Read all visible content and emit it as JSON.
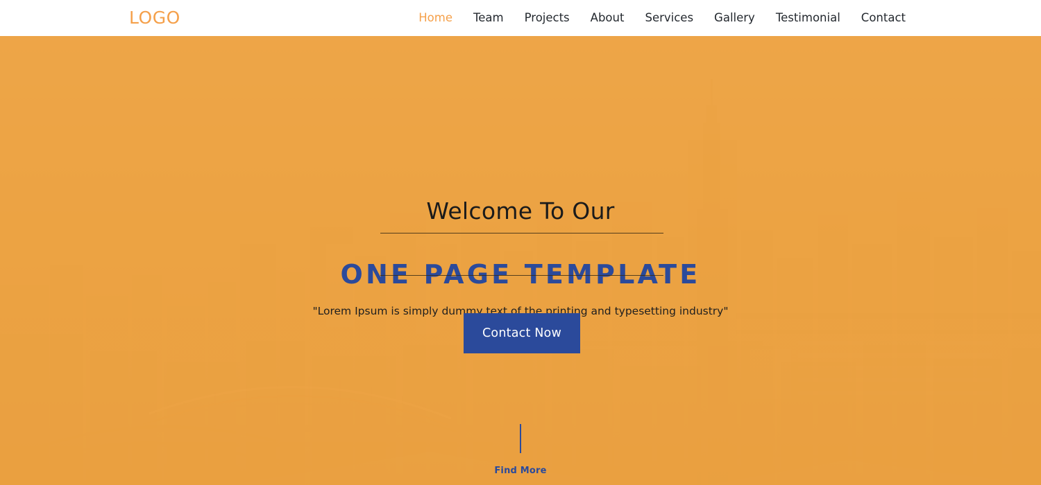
{
  "header": {
    "logo_text": "LOGO",
    "nav_items": [
      {
        "label": "Home",
        "active": true
      },
      {
        "label": "Team",
        "active": false
      },
      {
        "label": "Projects",
        "active": false
      },
      {
        "label": "About",
        "active": false
      },
      {
        "label": "Services",
        "active": false
      },
      {
        "label": "Gallery",
        "active": false
      },
      {
        "label": "Testimonial",
        "active": false
      },
      {
        "label": "Contact",
        "active": false
      }
    ]
  },
  "hero": {
    "welcome_text": "Welcome To Our",
    "title": "ONE PAGE TEMPLATE",
    "tagline": "\"Lorem Ipsum is simply dummy text of the printing and typesetting industry\"",
    "cta_label": "Contact Now",
    "scroll_label": "Find More",
    "background_description": "city skyline with arch bridge, orange tinted photo"
  },
  "colors": {
    "brand_orange": "#F5A04A",
    "hero_overlay": "#EDA444",
    "accent_blue": "#2B4A9B",
    "nav_text": "#24292f",
    "header_bg": "#ffffff",
    "rule": "#3a2c14"
  }
}
